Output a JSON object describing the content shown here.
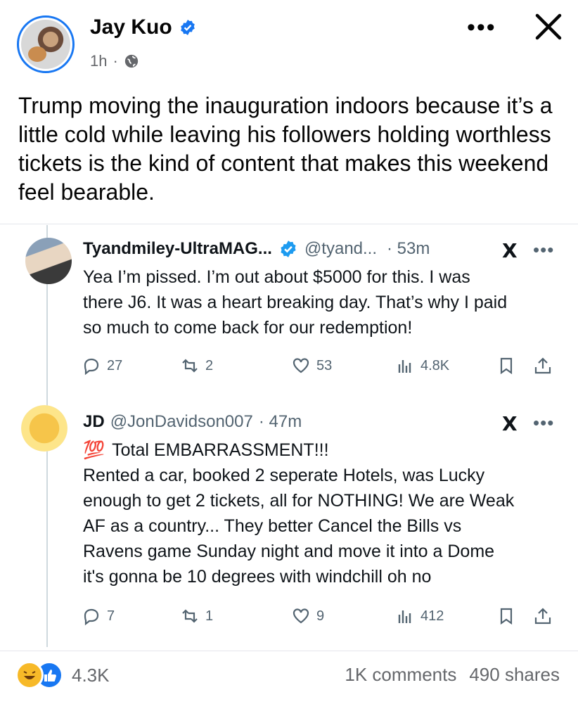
{
  "post": {
    "author": "Jay Kuo",
    "time": "1h",
    "separator": "·",
    "more_label": "•••",
    "text": "Trump moving the inauguration indoors because it’s a little cold while leaving his followers holding worthless tickets is the kind of content that makes this weekend feel bearable."
  },
  "embedded_tweets": [
    {
      "name": "Tyandmiley-UltraMAG...",
      "handle": "@tyand...",
      "time": "· 53m",
      "text_lines": [
        "Yea I’m pissed. I’m out about $5000 for this.  I was",
        "there J6. It was a heart breaking day. That’s why I paid",
        "so much to come back for our redemption!"
      ],
      "replies": "27",
      "retweets": "2",
      "likes": "53",
      "views": "4.8K"
    },
    {
      "name": "JD",
      "handle": "@JonDavidson007",
      "time": "· 47m",
      "emoji": "💯",
      "text_lines": [
        "Total EMBARRASSMENT!!!",
        "Rented a car, booked 2 seperate Hotels, was Lucky",
        "enough to get 2 tickets, all for NOTHING!  We are Weak",
        "AF as a country...  They better Cancel the Bills vs",
        "Ravens game Sunday night and move it into a Dome",
        "it's gonna be 10 degrees with windchill oh no"
      ],
      "replies": "7",
      "retweets": "1",
      "likes": "9",
      "views": "412"
    }
  ],
  "x_logo_text": "X",
  "tweet_more": "•••",
  "footer": {
    "reactions_count": "4.3K",
    "comments": "1K comments",
    "shares": "490 shares"
  },
  "colors": {
    "facebook_blue": "#1877f2",
    "verified_blue": "#1d9bf0",
    "muted": "#65676b",
    "twitter_muted": "#536471"
  }
}
